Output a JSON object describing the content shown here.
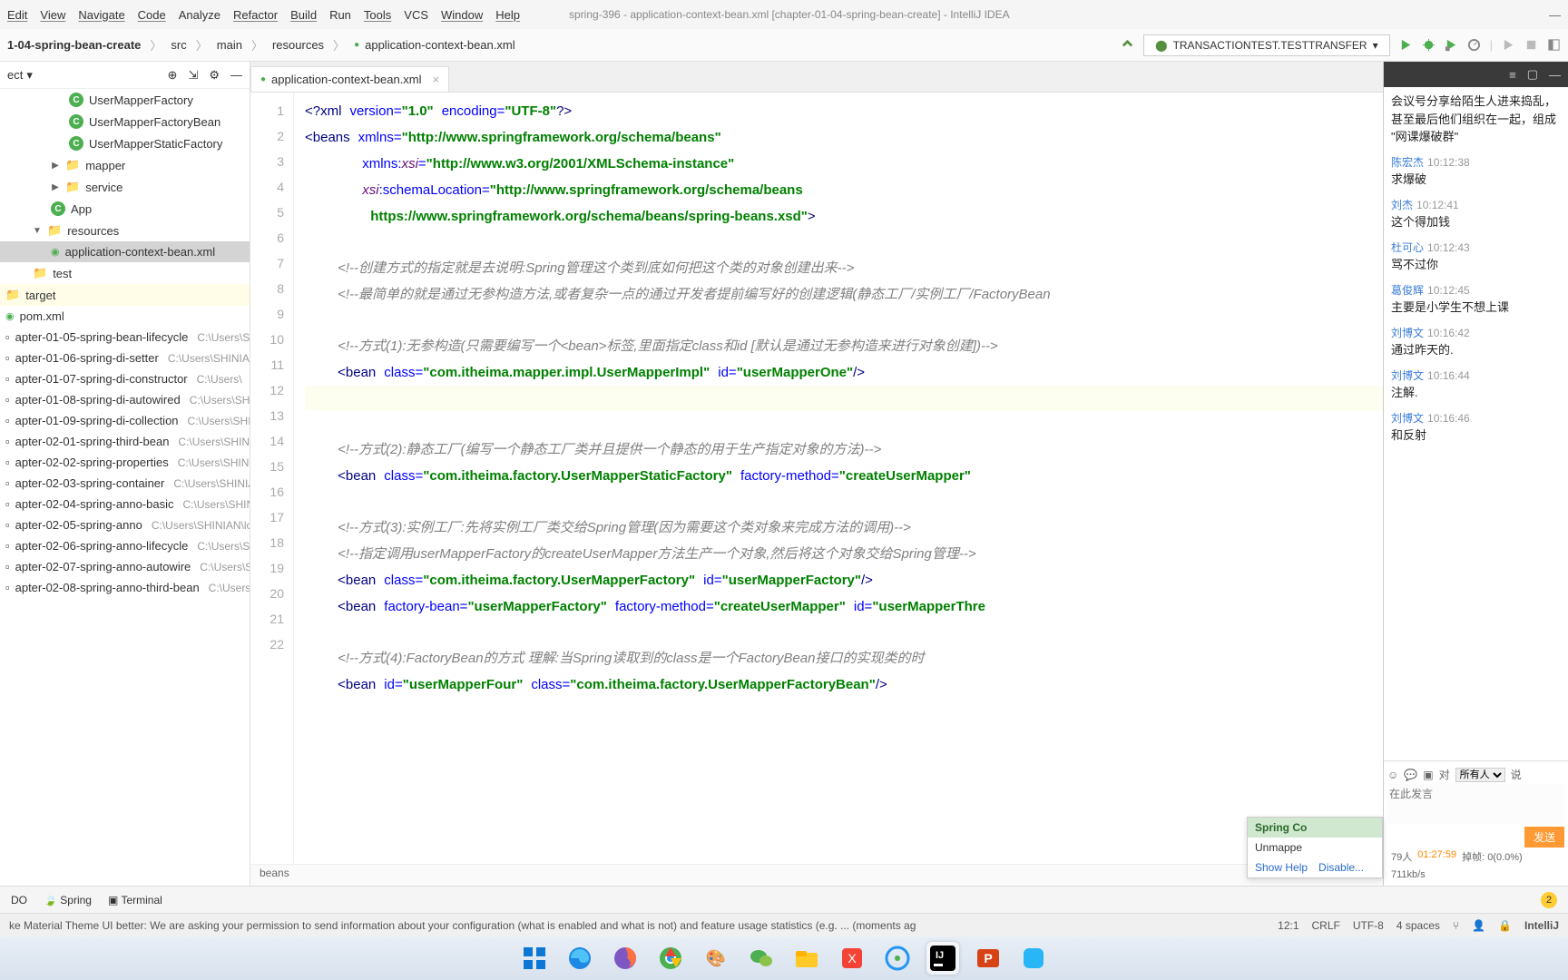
{
  "window": {
    "title": "spring-396 - application-context-bean.xml [chapter-01-04-spring-bean-create] - IntelliJ IDEA"
  },
  "menus": [
    "Edit",
    "View",
    "Navigate",
    "Code",
    "Analyze",
    "Refactor",
    "Build",
    "Run",
    "Tools",
    "VCS",
    "Window",
    "Help"
  ],
  "breadcrumbs": [
    "1-04-spring-bean-create",
    "src",
    "main",
    "resources",
    "application-context-bean.xml"
  ],
  "runconfig": "TRANSACTIONTEST.TESTTRANSFER",
  "tree": {
    "header_label": "ect",
    "items": [
      {
        "icon": "c",
        "label": "UserMapperFactory",
        "indent": 3
      },
      {
        "icon": "c",
        "label": "UserMapperFactoryBean",
        "indent": 3
      },
      {
        "icon": "c",
        "label": "UserMapperStaticFactory",
        "indent": 3
      },
      {
        "icon": "folder",
        "arrow": "▶",
        "label": "mapper",
        "indent": 2
      },
      {
        "icon": "folder",
        "arrow": "▶",
        "label": "service",
        "indent": 2
      },
      {
        "icon": "c",
        "label": "App",
        "indent": 2
      },
      {
        "icon": "folder",
        "arrow": "▼",
        "label": "resources",
        "indent": 1
      },
      {
        "icon": "xml",
        "label": "application-context-bean.xml",
        "indent": 2,
        "selected": true
      },
      {
        "icon": "folder",
        "label": "test",
        "indent": 1
      },
      {
        "icon": "folder",
        "label": "target",
        "indent": 0,
        "excluded": true
      },
      {
        "icon": "xml",
        "label": "pom.xml",
        "indent": 0
      },
      {
        "icon": "mod",
        "label": "apter-01-05-spring-bean-lifecycle",
        "dim": "C:\\Users\\S",
        "indent": 0
      },
      {
        "icon": "mod",
        "label": "apter-01-06-spring-di-setter",
        "dim": "C:\\Users\\SHINIA",
        "indent": 0
      },
      {
        "icon": "mod",
        "label": "apter-01-07-spring-di-constructor",
        "dim": "C:\\Users\\",
        "indent": 0
      },
      {
        "icon": "mod",
        "label": "apter-01-08-spring-di-autowired",
        "dim": "C:\\Users\\SH",
        "indent": 0
      },
      {
        "icon": "mod",
        "label": "apter-01-09-spring-di-collection",
        "dim": "C:\\Users\\SHI",
        "indent": 0
      },
      {
        "icon": "mod",
        "label": "apter-02-01-spring-third-bean",
        "dim": "C:\\Users\\SHINIA",
        "indent": 0
      },
      {
        "icon": "mod",
        "label": "apter-02-02-spring-properties",
        "dim": "C:\\Users\\SHINI",
        "indent": 0
      },
      {
        "icon": "mod",
        "label": "apter-02-03-spring-container",
        "dim": "C:\\Users\\SHINIA",
        "indent": 0
      },
      {
        "icon": "mod",
        "label": "apter-02-04-spring-anno-basic",
        "dim": "C:\\Users\\SHINI",
        "indent": 0
      },
      {
        "icon": "mod",
        "label": "apter-02-05-spring-anno",
        "dim": "C:\\Users\\SHINIAN\\lo",
        "indent": 0
      },
      {
        "icon": "mod",
        "label": "apter-02-06-spring-anno-lifecycle",
        "dim": "C:\\Users\\SI",
        "indent": 0
      },
      {
        "icon": "mod",
        "label": "apter-02-07-spring-anno-autowire",
        "dim": "C:\\Users\\SH",
        "indent": 0
      },
      {
        "icon": "mod",
        "label": "apter-02-08-spring-anno-third-bean",
        "dim": "C:\\Users\\",
        "indent": 0
      }
    ]
  },
  "editor": {
    "tab_label": "application-context-bean.xml",
    "lines": [
      1,
      2,
      3,
      4,
      5,
      6,
      7,
      8,
      9,
      10,
      11,
      12,
      13,
      14,
      15,
      16,
      17,
      18,
      19,
      20,
      21,
      22
    ],
    "crumb": "beans"
  },
  "chat": {
    "pre_text": "会议号分享给陌生人进来捣乱，甚至最后他们组织在一起，组成 \"网课爆破群\"",
    "messages": [
      {
        "name": "陈宏杰",
        "time": "10:12:38",
        "text": "求爆破"
      },
      {
        "name": "刘杰",
        "time": "10:12:41",
        "text": "这个得加钱"
      },
      {
        "name": "杜可心",
        "time": "10:12:43",
        "text": "骂不过你"
      },
      {
        "name": "葛俊辉",
        "time": "10:12:45",
        "text": "主要是小学生不想上课"
      },
      {
        "name": "刘博文",
        "time": "10:16:42",
        "text": "通过昨天的."
      },
      {
        "name": "刘博文",
        "time": "10:16:44",
        "text": "注解."
      },
      {
        "name": "刘博文",
        "time": "10:16:46",
        "text": "和反射"
      }
    ],
    "to_label": "对",
    "audience": "所有人",
    "say_label": "说",
    "placeholder": "在此发言",
    "send": "发送",
    "viewers": "79人",
    "elapsed": "01:27:59",
    "drop": "掉帧: 0(0.0%)",
    "bitrate": "711kb/s"
  },
  "popup": {
    "title": "Spring Co",
    "body": "Unmappe",
    "show_help": "Show Help",
    "disable": "Disable..."
  },
  "toolwin": {
    "todo": "DO",
    "spring": "Spring",
    "terminal": "Terminal",
    "badge": "2"
  },
  "status": {
    "msg": "ke Material Theme UI better: We are asking your permission to send information about your configuration (what is enabled and what is not) and feature usage statistics (e.g. ... (moments ag",
    "pos": "12:1",
    "eol": "CRLF",
    "enc": "UTF-8",
    "indent": "4 spaces",
    "brand": "IntelliJ"
  },
  "taskbar": [
    "windows",
    "edge",
    "firefox",
    "chrome",
    "paint",
    "wechat",
    "files",
    "qq",
    "assistant",
    "intellij",
    "powerpoint",
    "app"
  ]
}
